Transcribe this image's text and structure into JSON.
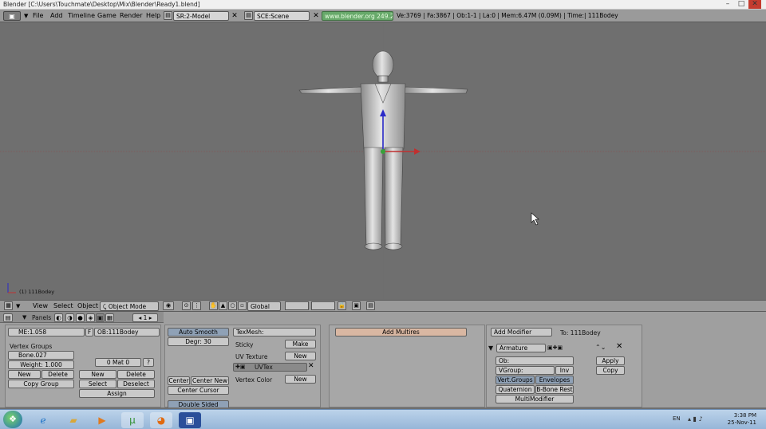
{
  "window": {
    "title": "Blender [C:\\Users\\Touchmate\\Desktop\\Mix\\Blender\\Ready1.blend]",
    "minimize": "–",
    "maximize": "□",
    "close": "✕"
  },
  "topbar": {
    "menus": [
      "File",
      "Add",
      "Timeline",
      "Game",
      "Render",
      "Help"
    ],
    "screen_field": "SR:2-Model",
    "scene_field": "SCE:Scene",
    "url": "www.blender.org 249.2",
    "stats": "Ve:3769 | Fa:3867 | Ob:1-1 | La:0 | Mem:6.47M (0.09M) | Time:| 111Bodey"
  },
  "viewport": {
    "object_label": "(1) 111Bodey"
  },
  "view3d_header": {
    "menus": [
      "View",
      "Select",
      "Object"
    ],
    "mode": "Object Mode",
    "orientation": "Global"
  },
  "buttons_header": {
    "panels_label": "Panels",
    "frame": "1"
  },
  "link_materials": {
    "me_field": "ME:1.058",
    "f_label": "F",
    "ob_field": "OB:111Bodey",
    "vertex_groups_label": "Vertex Groups",
    "bone_field": "Bone.027",
    "weight_field": "Weight: 1.000",
    "new_label": "New",
    "delete_label": "Delete",
    "copy_group_label": "Copy Group",
    "mat_field": "0 Mat 0",
    "question": "?",
    "mat_new": "New",
    "mat_delete": "Delete",
    "select_label": "Select",
    "deselect_label": "Deselect",
    "assign_label": "Assign"
  },
  "mesh_panel": {
    "auto_smooth": "Auto Smooth",
    "degr": "Degr: 30",
    "center": "Center",
    "center_new": "Center New",
    "center_cursor": "Center Cursor",
    "double_sided": "Double Sided",
    "texmesh": "TexMesh:",
    "sticky": "Sticky",
    "make": "Make",
    "uv_texture": "UV Texture",
    "uv_new": "New",
    "uvtex": "UVTex",
    "uvtex_x": "✕",
    "vertex_color": "Vertex Color",
    "vc_new": "New"
  },
  "multires": {
    "add_multires": "Add Multires"
  },
  "modifiers": {
    "add_modifier": "Add Modifier",
    "to_label": "To: 111Bodey",
    "armature_name": "Armature",
    "ob_field": "Ob:",
    "vgroup_field": "VGroup:",
    "inv": "Inv",
    "vert_groups": "Vert.Groups",
    "envelopes": "Envelopes",
    "quaternion": "Quaternion",
    "bbone_rest": "B-Bone Rest",
    "multimodifier": "MultiModifier",
    "apply": "Apply",
    "copy": "Copy",
    "close_x": "✕"
  },
  "taskbar": {
    "lang": "EN",
    "time": "3:38 PM",
    "date": "25-Nov-11"
  },
  "colors": {
    "viewport_bg": "#6f6f6f",
    "header_bg": "#9a9a9a",
    "url_green": "#67a96a",
    "axis_red": "#c03030",
    "axis_green": "#37a13a",
    "axis_blue": "#2a2ac8"
  }
}
